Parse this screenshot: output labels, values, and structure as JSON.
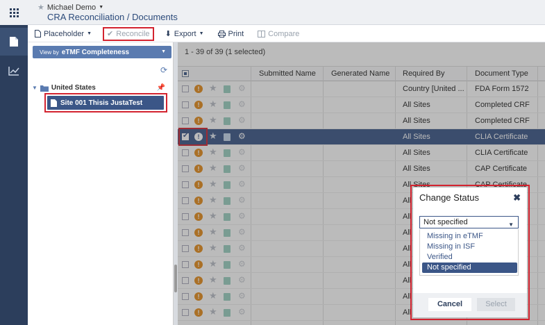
{
  "header": {
    "user": "Michael Demo",
    "title": "CRA Reconciliation / Documents"
  },
  "toolbar": {
    "placeholder_label": "Placeholder",
    "reconcile_label": "Reconcile",
    "export_label": "Export",
    "print_label": "Print",
    "compare_label": "Compare"
  },
  "left_panel": {
    "view_by_prefix": "View by",
    "view_by_value": "eTMF Completeness",
    "tree": {
      "country": "United States",
      "site": "Site 001 Thisis JustaTest"
    }
  },
  "grid": {
    "count_text": "1 - 39 of 39 (1 selected)",
    "columns": [
      "Submitted Name",
      "Generated Name",
      "Required By",
      "Document Type"
    ],
    "rows": [
      {
        "required_by": "Country [United ...",
        "doc_type": "FDA Form 1572",
        "selected": false
      },
      {
        "required_by": "All Sites",
        "doc_type": "Completed CRF",
        "selected": false
      },
      {
        "required_by": "All Sites",
        "doc_type": "Completed CRF",
        "selected": false
      },
      {
        "required_by": "All Sites",
        "doc_type": "CLIA Certificate",
        "selected": true
      },
      {
        "required_by": "All Sites",
        "doc_type": "CLIA Certificate",
        "selected": false
      },
      {
        "required_by": "All Sites",
        "doc_type": "CAP Certificate",
        "selected": false
      },
      {
        "required_by": "All Sites",
        "doc_type": "CAP Certificate",
        "selected": false
      },
      {
        "required_by": "All",
        "doc_type": "",
        "selected": false
      },
      {
        "required_by": "All",
        "doc_type": "",
        "selected": false
      },
      {
        "required_by": "All",
        "doc_type": "",
        "selected": false
      },
      {
        "required_by": "All",
        "doc_type": "",
        "selected": false
      },
      {
        "required_by": "All",
        "doc_type": "",
        "selected": false
      },
      {
        "required_by": "All",
        "doc_type": "",
        "selected": false
      },
      {
        "required_by": "All",
        "doc_type": "",
        "selected": false
      },
      {
        "required_by": "All",
        "doc_type": "",
        "selected": false
      }
    ]
  },
  "modal": {
    "title": "Change Status",
    "selected_value": "Not specified",
    "options": [
      "Missing in eTMF",
      "Missing in ISF",
      "Verified",
      "Not specified"
    ],
    "cancel_label": "Cancel",
    "select_label": "Select"
  },
  "colors": {
    "nav": "#2c3e5c",
    "accent": "#3b5687",
    "warning": "#e58d1b",
    "highlight": "#d3232f"
  }
}
